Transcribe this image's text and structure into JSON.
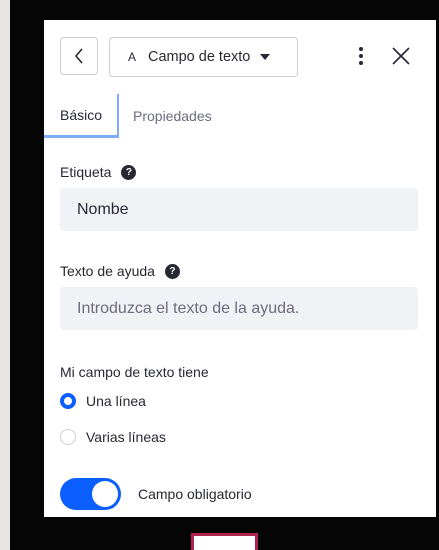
{
  "header": {
    "field_type_glyph": "A",
    "field_type_label": "Campo de texto"
  },
  "tabs": [
    {
      "label": "Básico",
      "active": true
    },
    {
      "label": "Propiedades",
      "active": false
    }
  ],
  "label_field": {
    "label": "Etiqueta",
    "help_glyph": "?",
    "value": "Nombe"
  },
  "help_text_field": {
    "label": "Texto de ayuda",
    "help_glyph": "?",
    "placeholder": "Introduzca el texto de la ayuda."
  },
  "lines_option": {
    "label": "Mi campo de texto tiene",
    "options": [
      {
        "label": "Una línea",
        "checked": true
      },
      {
        "label": "Varias líneas",
        "checked": false
      }
    ]
  },
  "required_toggle": {
    "label": "Campo obligatorio",
    "on": true
  },
  "colors": {
    "accent": "#0b5fff",
    "tab_indicator": "#80acff",
    "input_bg": "#f1f2f5",
    "frame": "#050505",
    "bottom_highlight": "#b0254f"
  },
  "icons": [
    "chevron-left-icon",
    "caret-down-icon",
    "kebab-menu-icon",
    "close-icon",
    "help-icon"
  ]
}
